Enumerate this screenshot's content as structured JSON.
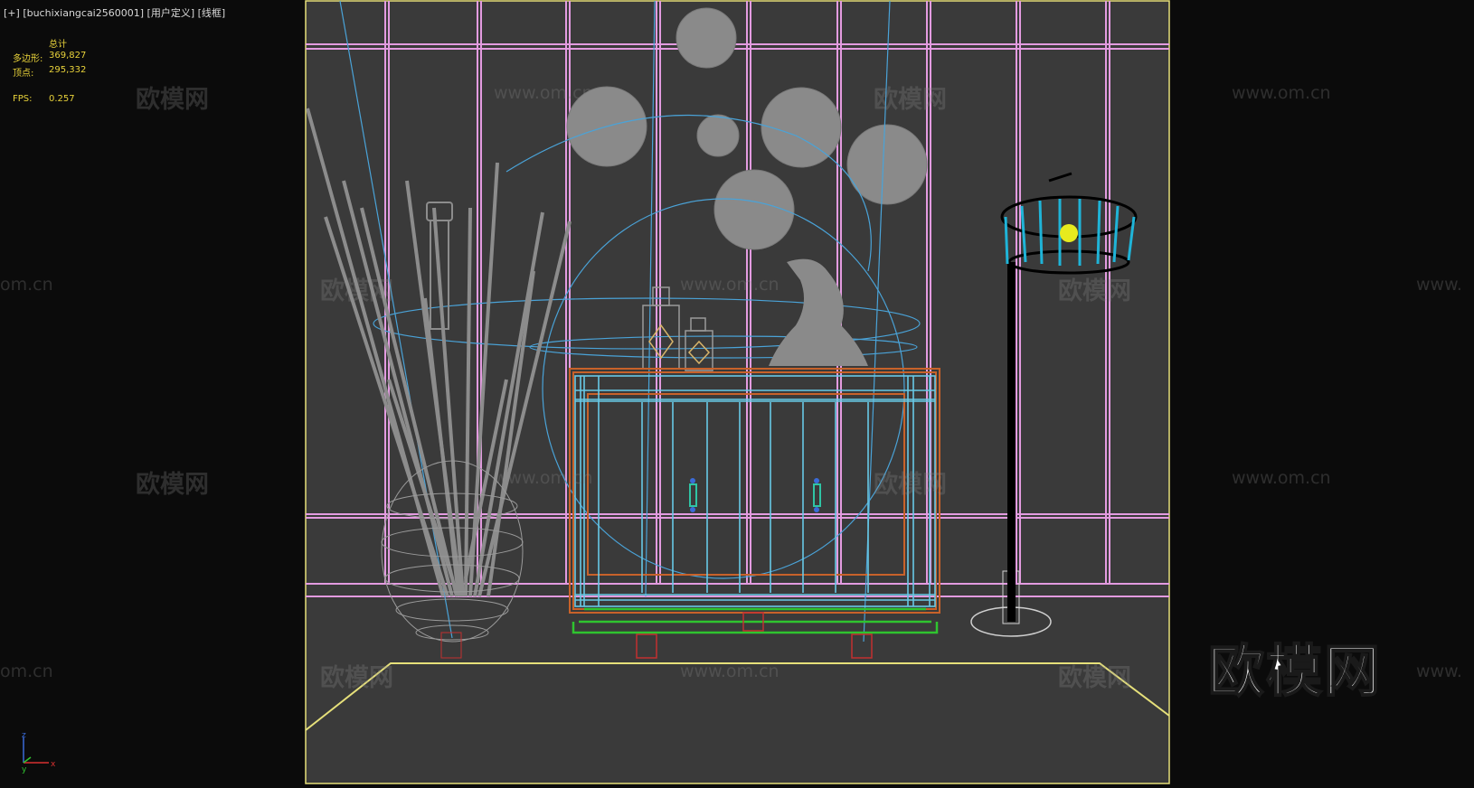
{
  "viewport": {
    "plus": "[+]",
    "camera": "[buchixiangcai2560001]",
    "view_mode": "[用户定义]",
    "shading": "[线框]"
  },
  "stats": {
    "header": "总计",
    "polygons_label": "多边形:",
    "polygons_value": "369,827",
    "vertices_label": "顶点:",
    "vertices_value": "295,332",
    "fps_label": "FPS:",
    "fps_value": "0.257"
  },
  "watermarks": {
    "site": "www.om.cn",
    "site_partial": "om.cn",
    "site_cut": "www.",
    "brand": "欧模网"
  },
  "logo": "欧模网",
  "axis": {
    "z": "z",
    "y": "y",
    "x": "x"
  },
  "colors": {
    "viewport_bg": "#0b0b0b",
    "render_frame": "#e6e07a",
    "scene_bg": "#3a3a3a",
    "wall_lines": "#e39be0",
    "cabinet_cyan": "#68c9e6",
    "cabinet_orange": "#c8622a",
    "base_green": "#2fc42f",
    "lamp_cyan": "#1fb4d8",
    "grey_mesh": "#8a8a8a"
  }
}
